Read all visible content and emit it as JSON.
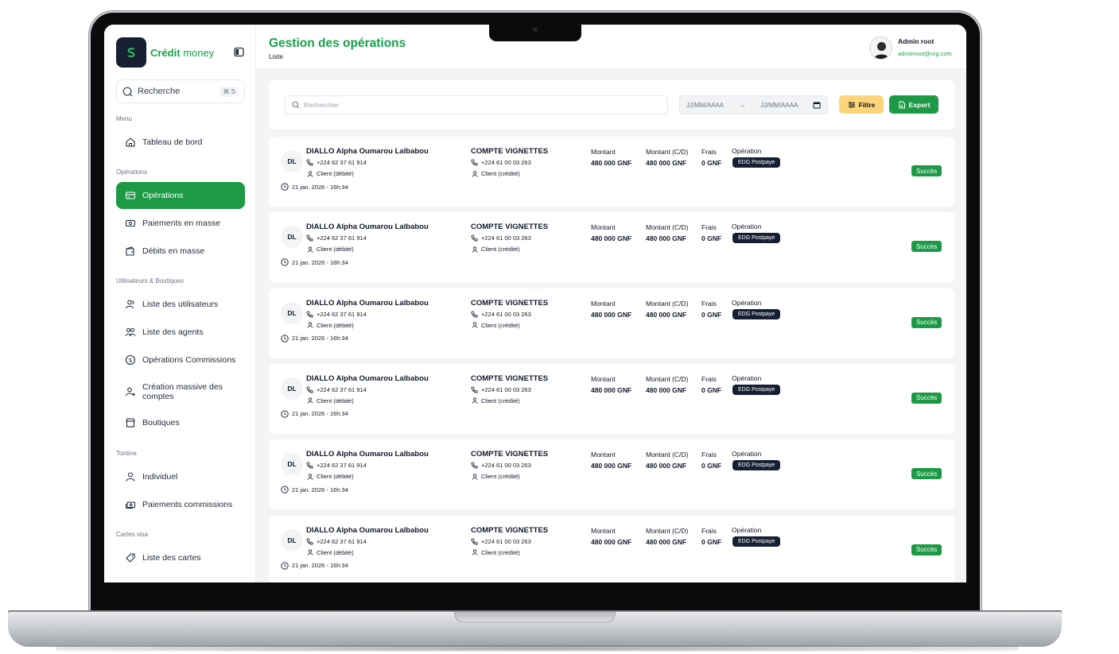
{
  "app": {
    "brand_strong": "Crédit",
    "brand_light": "money",
    "search_label": "Recherche",
    "search_shortcut": "⌘ S"
  },
  "sidebar": {
    "sections": [
      {
        "title": "Menu"
      },
      {
        "title": "Opérations"
      },
      {
        "title": "Utilisateurs & Boutiques"
      },
      {
        "title": "Tontine"
      },
      {
        "title": "Cartes visa"
      }
    ],
    "items": [
      {
        "label": "Tableau de bord",
        "icon": "home-icon"
      },
      {
        "label": "Opérations",
        "icon": "card-icon",
        "active": true
      },
      {
        "label": "Paiements en masse",
        "icon": "money-transfer-icon"
      },
      {
        "label": "Débits en masse",
        "icon": "wallet-icon"
      },
      {
        "label": "Liste des utilisateurs",
        "icon": "users-icon"
      },
      {
        "label": "Liste des agents",
        "icon": "agents-icon"
      },
      {
        "label": "Opérations Commissions",
        "icon": "commission-icon"
      },
      {
        "label": "Création massive des comptes",
        "icon": "user-add-icon"
      },
      {
        "label": "Boutiques",
        "icon": "shop-icon"
      },
      {
        "label": "Individuel",
        "icon": "user-icon"
      },
      {
        "label": "Paiements commissions",
        "icon": "cash-icon"
      },
      {
        "label": "Liste des cartes",
        "icon": "tag-icon"
      }
    ]
  },
  "header": {
    "title": "Gestion des opérations",
    "subtitle": "Liste",
    "user_name": "Admin root",
    "user_email": "adminroot@crg.com"
  },
  "filters": {
    "search_placeholder": "Rechercher",
    "date_from": "JJ/MM/AAAA",
    "date_to": "JJ/MM/AAAA",
    "filter_label": "Filtre",
    "export_label": "Export"
  },
  "colors": {
    "accent": "#1e9a47",
    "brand_dark": "#172033",
    "filter_button": "#fcd47a"
  },
  "operations": [
    {
      "initials": "DL",
      "name": "DIALLO Alpha Oumarou Lalbabou",
      "phone": "+224 62 37 61 914",
      "role": "Client (débité)",
      "date": "21 jan. 2026 - 16h:34",
      "account": "COMPTE VIGNETTES",
      "account_phone": "+224 61 00 03 263",
      "account_role": "Client (crédité)",
      "amount_label": "Montant",
      "amount": "480 000 GNF",
      "amount_cd_label": "Montant (C/D)",
      "amount_cd": "480 000 GNF",
      "fee_label": "Frais",
      "fee": "0 GNF",
      "type_label": "Opération",
      "type": "EDG Postpaye",
      "status": "Succès"
    },
    {
      "initials": "DL",
      "name": "DIALLO Alpha Oumarou Lalbabou",
      "phone": "+224 62 37 61 914",
      "role": "Client (débité)",
      "date": "21 jan. 2026 - 16h:34",
      "account": "COMPTE VIGNETTES",
      "account_phone": "+224 61 00 03 263",
      "account_role": "Client (crédité)",
      "amount_label": "Montant",
      "amount": "480 000 GNF",
      "amount_cd_label": "Montant (C/D)",
      "amount_cd": "480 000 GNF",
      "fee_label": "Frais",
      "fee": "0 GNF",
      "type_label": "Opération",
      "type": "EDG Postpaye",
      "status": "Succès"
    },
    {
      "initials": "DL",
      "name": "DIALLO Alpha Oumarou Lalbabou",
      "phone": "+224 62 37 61 914",
      "role": "Client (débité)",
      "date": "21 jan. 2026 - 16h:34",
      "account": "COMPTE VIGNETTES",
      "account_phone": "+224 61 00 03 263",
      "account_role": "Client (crédité)",
      "amount_label": "Montant",
      "amount": "480 000 GNF",
      "amount_cd_label": "Montant (C/D)",
      "amount_cd": "480 000 GNF",
      "fee_label": "Frais",
      "fee": "0 GNF",
      "type_label": "Opération",
      "type": "EDG Postpaye",
      "status": "Succès"
    },
    {
      "initials": "DL",
      "name": "DIALLO Alpha Oumarou Lalbabou",
      "phone": "+224 62 37 61 914",
      "role": "Client (débité)",
      "date": "21 jan. 2026 - 16h:34",
      "account": "COMPTE VIGNETTES",
      "account_phone": "+224 61 00 03 263",
      "account_role": "Client (crédité)",
      "amount_label": "Montant",
      "amount": "480 000 GNF",
      "amount_cd_label": "Montant (C/D)",
      "amount_cd": "480 000 GNF",
      "fee_label": "Frais",
      "fee": "0 GNF",
      "type_label": "Opération",
      "type": "EDG Postpaye",
      "status": "Succès"
    },
    {
      "initials": "DL",
      "name": "DIALLO Alpha Oumarou Lalbabou",
      "phone": "+224 62 37 61 914",
      "role": "Client (débité)",
      "date": "21 jan. 2026 - 16h:34",
      "account": "COMPTE VIGNETTES",
      "account_phone": "+224 61 00 03 263",
      "account_role": "Client (crédité)",
      "amount_label": "Montant",
      "amount": "480 000 GNF",
      "amount_cd_label": "Montant (C/D)",
      "amount_cd": "480 000 GNF",
      "fee_label": "Frais",
      "fee": "0 GNF",
      "type_label": "Opération",
      "type": "EDG Postpaye",
      "status": "Succès"
    },
    {
      "initials": "DL",
      "name": "DIALLO Alpha Oumarou Lalbabou",
      "phone": "+224 62 37 61 914",
      "role": "Client (débité)",
      "date": "21 jan. 2026 - 16h:34",
      "account": "COMPTE VIGNETTES",
      "account_phone": "+224 61 00 03 263",
      "account_role": "Client (crédité)",
      "amount_label": "Montant",
      "amount": "480 000 GNF",
      "amount_cd_label": "Montant (C/D)",
      "amount_cd": "480 000 GNF",
      "fee_label": "Frais",
      "fee": "0 GNF",
      "type_label": "Opération",
      "type": "EDG Postpaye",
      "status": "Succès"
    }
  ]
}
